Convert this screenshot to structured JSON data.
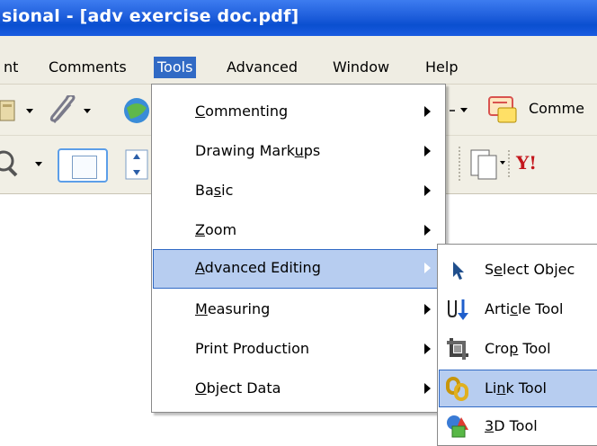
{
  "window": {
    "title": "sional - [adv exercise doc.pdf]"
  },
  "menubar": {
    "items": [
      {
        "label": "nt"
      },
      {
        "label": "Comments"
      },
      {
        "label": "Tools"
      },
      {
        "label": "Advanced"
      },
      {
        "label": "Window"
      },
      {
        "label": "Help"
      }
    ]
  },
  "toolbar": {
    "comment_label": "Comme"
  },
  "tools_menu": {
    "items": [
      {
        "pre": "",
        "key": "C",
        "post": "ommenting"
      },
      {
        "pre": "Drawing Mark",
        "key": "u",
        "post": "ps"
      },
      {
        "pre": "Ba",
        "key": "s",
        "post": "ic"
      },
      {
        "pre": "",
        "key": "Z",
        "post": "oom"
      },
      {
        "pre": "",
        "key": "A",
        "post": "dvanced Editing"
      },
      {
        "pre": "",
        "key": "M",
        "post": "easuring"
      },
      {
        "pre": "Print Production",
        "key": "",
        "post": ""
      },
      {
        "pre": "",
        "key": "O",
        "post": "bject Data"
      }
    ]
  },
  "advanced_editing_submenu": {
    "items": [
      {
        "pre": "S",
        "key": "e",
        "post": "lect Objec",
        "icon": "select-object-icon"
      },
      {
        "pre": "Arti",
        "key": "c",
        "post": "le Tool",
        "icon": "article-tool-icon"
      },
      {
        "pre": "Cro",
        "key": "p",
        "post": " Tool",
        "icon": "crop-tool-icon"
      },
      {
        "pre": "Li",
        "key": "n",
        "post": "k Tool",
        "icon": "link-tool-icon"
      },
      {
        "pre": "",
        "key": "3",
        "post": "D Tool",
        "icon": "3d-tool-icon"
      }
    ]
  },
  "colors": {
    "titlebar": "#0a4fd0",
    "menu_highlight": "#316ac5",
    "item_selected": "#b7cdf0",
    "chrome": "#efede3"
  }
}
